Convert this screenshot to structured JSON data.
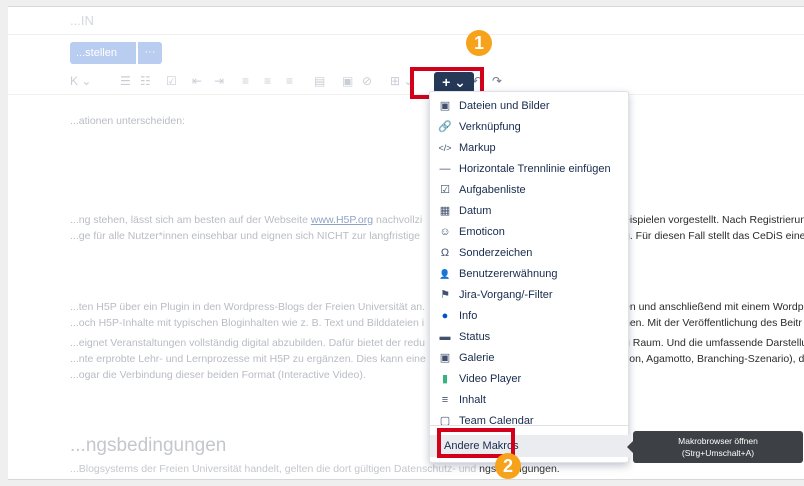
{
  "page": {
    "top_title": "...IN",
    "publish_label": "...stellen",
    "more_label": "···"
  },
  "toolbar": {
    "insert_label": "+ ⌄",
    "undo": "↶",
    "redo": "↷"
  },
  "badges": {
    "one": "1",
    "two": "2"
  },
  "content": {
    "line1": "...ationen unterscheiden:",
    "line2a": "...ng stehen, lässt sich am besten auf der Webseite ",
    "line2link": "www.H5P.org",
    "line2b": " nachvollzi",
    "line2r": "eispielen vorgestellt. Nach Registrierun",
    "line3a": "...ge für alle Nutzer*innen einsehbar und eignen sich NICHT zur langfristige",
    "line3r": "g. Für diesen Fall stellt das CeDiS eine",
    "line4a": "...ten H5P über ein Plugin in den Wordpress-Blogs der Freien Universität an.",
    "line4r": "en und anschließend mit einem Wordp",
    "line5a": "...och H5P-Inhalte mit typischen Bloginhalten wie z. B. Text und Bilddateien i",
    "line5r": "hen. Mit der Veröffentlichung des Beitr",
    "line6a": "...eignet Veranstaltungen vollständig digital abzubilden. Dafür bietet der redu",
    "line6r": "g Raum. Und die umfassende Darstellu",
    "line7a": "...nte erprobte Lehr- und Lernprozesse mit H5P zu ergänzen. Dies kann eine",
    "line7r": "tion, Agamotto, Branching-Szenario), d",
    "line8a": "...ogar die Verbindung dieser beiden Format (Interactive Video).",
    "heading": "...ngsbedingungen",
    "foot_a": "...Blogsystems der Freien Universität handelt, gelten die dort gültigen Datenschutz- und ",
    "foot_b": "ngsbedingungen."
  },
  "menu": {
    "items": [
      {
        "icon": "image-icon",
        "glyph": "▣",
        "label": "Dateien und Bilder"
      },
      {
        "icon": "link-icon",
        "glyph": "🔗",
        "label": "Verknüpfung"
      },
      {
        "icon": "markup-icon",
        "glyph": "</>",
        "label": "Markup"
      },
      {
        "icon": "horizontal-rule-icon",
        "glyph": "—",
        "label": "Horizontale Trennlinie einfügen"
      },
      {
        "icon": "checkbox-icon",
        "glyph": "☑",
        "label": "Aufgabenliste"
      },
      {
        "icon": "calendar-icon",
        "glyph": "▦",
        "label": "Datum"
      },
      {
        "icon": "emoticon-icon",
        "glyph": "☺",
        "label": "Emoticon"
      },
      {
        "icon": "omega-icon",
        "glyph": "Ω",
        "label": "Sonderzeichen"
      },
      {
        "icon": "mention-icon",
        "glyph": "👤",
        "label": "Benutzererwähnung"
      },
      {
        "icon": "jira-icon",
        "glyph": "⚑",
        "label": "Jira-Vorgang/-Filter"
      },
      {
        "icon": "info-icon",
        "glyph": "●",
        "label": "Info"
      },
      {
        "icon": "status-icon",
        "glyph": "▬",
        "label": "Status"
      },
      {
        "icon": "gallery-icon",
        "glyph": "▣",
        "label": "Galerie"
      },
      {
        "icon": "video-icon",
        "glyph": "▮",
        "label": "Video Player"
      },
      {
        "icon": "toc-icon",
        "glyph": "≡",
        "label": "Inhalt"
      },
      {
        "icon": "team-calendar-icon",
        "glyph": "▢",
        "label": "Team Calendar"
      }
    ],
    "other_macros": "Andere Makros"
  },
  "tooltip": {
    "line1": "Makrobrowser öffnen",
    "line2": "(Strg+Umschalt+A)"
  },
  "colors": {
    "accent": "#253858",
    "highlight_red": "#d3001b",
    "badge_orange": "#f7a21b",
    "info_blue": "#0052cc"
  }
}
